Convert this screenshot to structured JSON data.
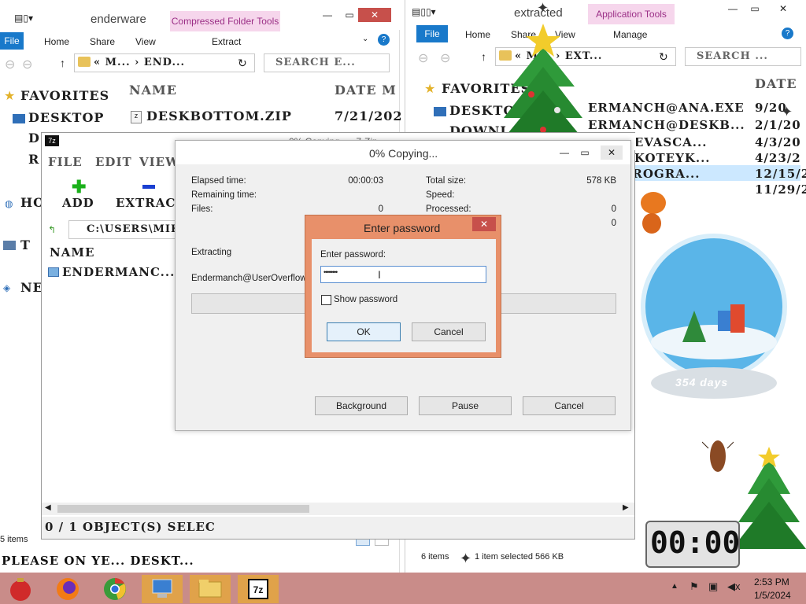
{
  "left_explorer": {
    "title": "enderware",
    "context_tab": "Compressed Folder Tools",
    "tabs": [
      "File",
      "Home",
      "Share",
      "View"
    ],
    "context_sub": "Extract",
    "breadcrumb": "« M... › END...",
    "search_placeholder": "SEARCH E...",
    "favorites_label": "FAVORITES",
    "nav_items": [
      "DESKTOP",
      "D",
      "R",
      "HO",
      "T",
      "NE"
    ],
    "col_name": "NAME",
    "col_date": "DATE M",
    "files": [
      {
        "name": "DESKBOTTOM.ZIP",
        "date": "7/21/202"
      }
    ],
    "status_items": "5 items"
  },
  "right_explorer": {
    "title": "extracted",
    "context_tab": "Application Tools",
    "tabs": [
      "File",
      "Home",
      "Share",
      "View"
    ],
    "context_sub": "Manage",
    "breadcrumb": "« M... › EXT...",
    "search_placeholder": "SEARCH ...",
    "favorites_label": "FAVORITES",
    "nav_items": [
      "DESKTOP",
      "DOWNL"
    ],
    "col_date": "DATE",
    "files": [
      {
        "name": "ERMANCH@ANA.EXE",
        "date": "9/20"
      },
      {
        "name": "ERMANCH@DESKB...",
        "date": "2/1/20"
      },
      {
        "name": "NCH@EVASCA...",
        "date": "4/3/20"
      },
      {
        "name": "NCH@KOTEYK...",
        "date": "4/23/2"
      },
      {
        "name": "CH@PROGRA...",
        "date": "12/15/2"
      },
      {
        "name": "",
        "date": "11/29/2"
      }
    ],
    "status_items": "6 items",
    "status_selected": "1 item selected  566 KB"
  },
  "sevenzip": {
    "behind_title": "0% Copying... - 7-Zip",
    "menu": [
      "FILE",
      "EDIT",
      "VIEW"
    ],
    "toolbar": [
      "ADD",
      "EXTRACT"
    ],
    "path": "C:\\USERS\\MIK",
    "col_name": "NAME",
    "item": "ENDERMANC...",
    "status": "0 / 1 OBJECT(S) SELEC"
  },
  "copy_dialog": {
    "title": "0% Copying...",
    "elapsed_label": "Elapsed time:",
    "elapsed_value": "00:00:03",
    "remaining_label": "Remaining time:",
    "files_label": "Files:",
    "files_value": "0",
    "total_label": "Total size:",
    "total_value": "578 KB",
    "speed_label": "Speed:",
    "processed_label": "Processed:",
    "processed_value": "0",
    "extra_value": "0",
    "extracting_label": "Extracting",
    "current_file": "Endermanch@UserOverflow.exe",
    "background_btn": "Background",
    "pause_btn": "Pause",
    "cancel_btn": "Cancel"
  },
  "password_dialog": {
    "title": "Enter password",
    "prompt": "Enter password:",
    "value": "••••••••",
    "show_password": "Show password",
    "ok": "OK",
    "cancel": "Cancel"
  },
  "desktop": {
    "marquee": "PLEASE ON YE... DESKT...",
    "snow_globe": "354 days",
    "clock_widget": "00:00"
  },
  "taskbar": {
    "time": "2:53 PM",
    "date": "1/5/2024",
    "icons": [
      "ornament-icon",
      "firefox-icon",
      "chrome-icon",
      "computer-icon",
      "folder-icon",
      "sevenzip-icon"
    ]
  },
  "colors": {
    "accent": "#1979ca",
    "taskbar": "#c98c89",
    "dialog_border": "#e8906a",
    "close": "#c7504b"
  }
}
